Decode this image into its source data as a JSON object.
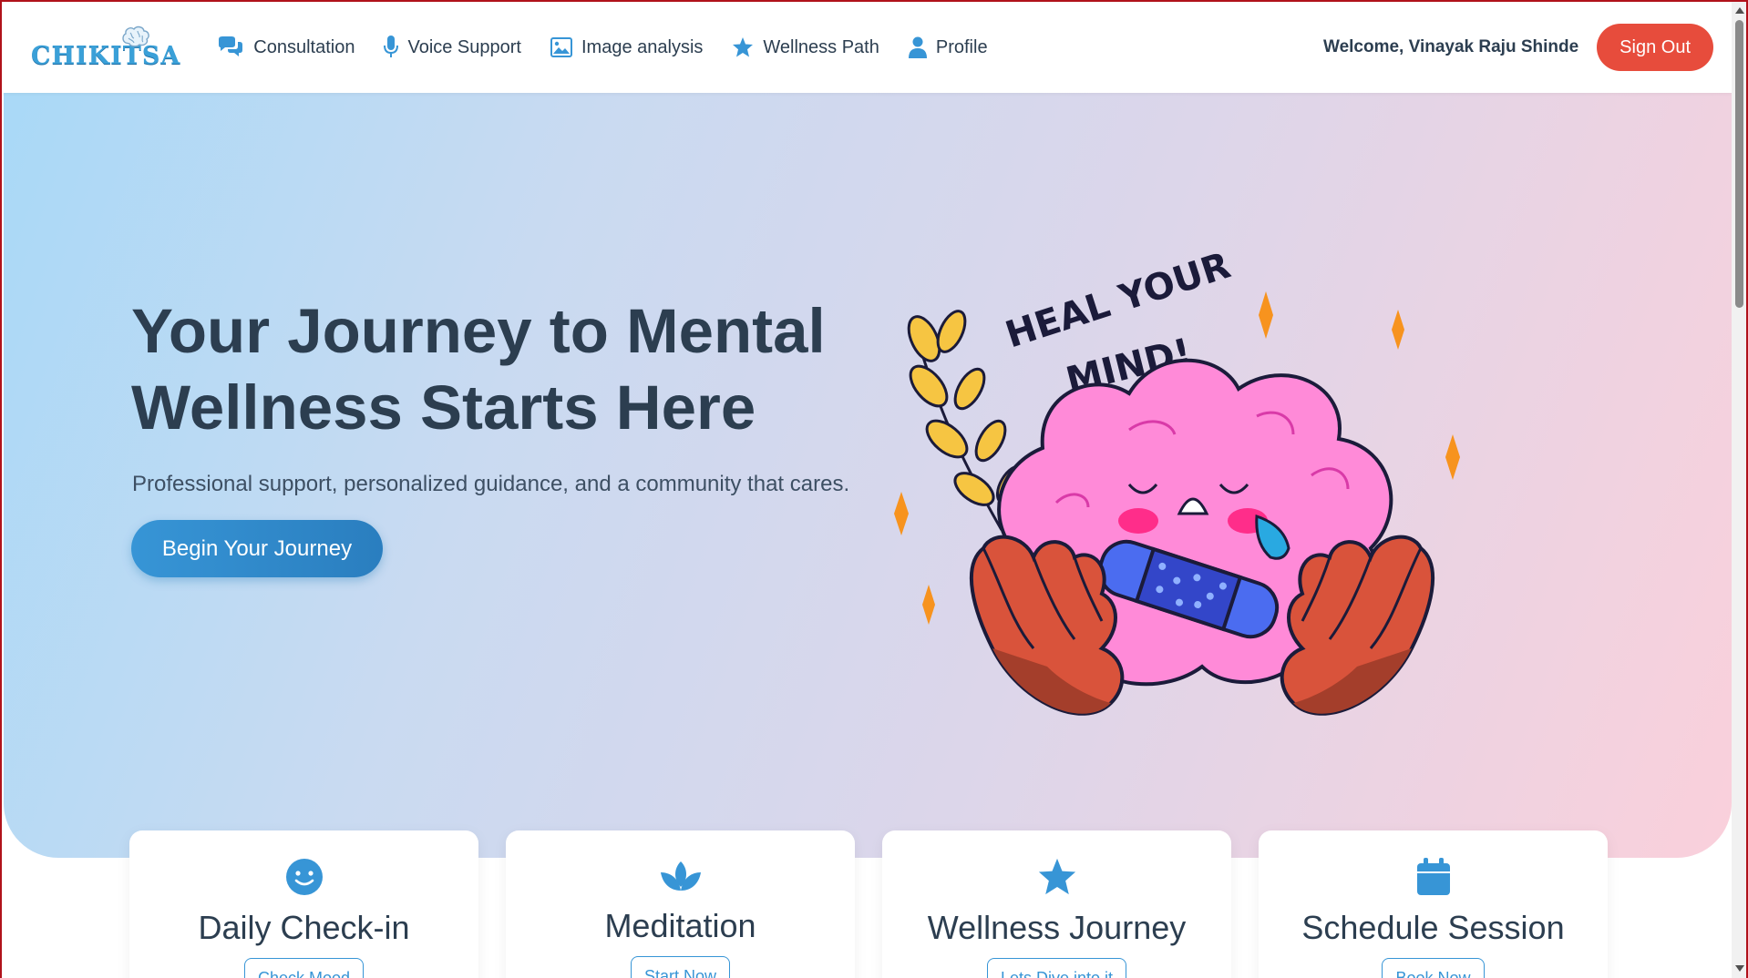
{
  "brand": {
    "name": "CHIKITSA",
    "color": "#3aa0d8"
  },
  "nav": {
    "items": [
      {
        "label": "Consultation",
        "icon": "chat-bubbles-icon"
      },
      {
        "label": "Voice Support",
        "icon": "microphone-icon"
      },
      {
        "label": "Image analysis",
        "icon": "image-icon"
      },
      {
        "label": "Wellness Path",
        "icon": "star-icon"
      },
      {
        "label": "Profile",
        "icon": "user-icon"
      }
    ],
    "welcome": "Welcome, Vinayak Raju Shinde",
    "signout_label": "Sign Out",
    "accent": "#3795d6",
    "signout_color": "#e74c3c"
  },
  "hero": {
    "title": "Your Journey to Mental Wellness Starts Here",
    "subtitle": "Professional support, personalized guidance, and a community that cares.",
    "cta_label": "Begin Your Journey",
    "illustration_text": "HEAL YOUR MIND!"
  },
  "cards": [
    {
      "title": "Daily Check-in",
      "button": "Check Mood",
      "icon": "smile-icon"
    },
    {
      "title": "Meditation",
      "button": "Start Now",
      "icon": "lotus-icon"
    },
    {
      "title": "Wellness Journey",
      "button": "Lets Dive into it",
      "icon": "star-icon"
    },
    {
      "title": "Schedule Session",
      "button": "Book Now",
      "icon": "calendar-icon"
    }
  ]
}
